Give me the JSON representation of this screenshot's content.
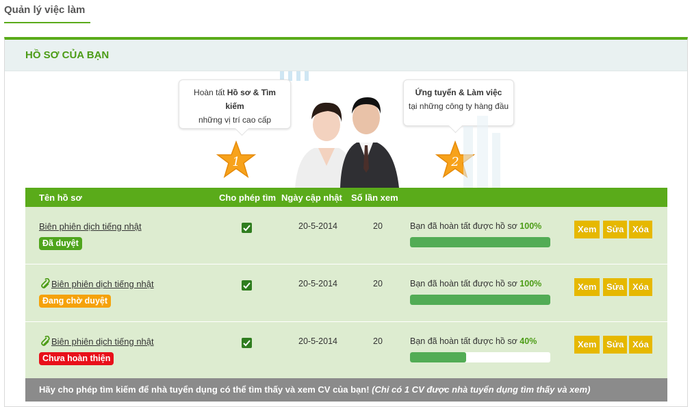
{
  "page_tab": "Quản lý việc làm",
  "panel": {
    "title": "HỒ SƠ CỦA BẠN",
    "banner": {
      "step1": {
        "number": "1",
        "line1_pre": "Hoàn tất ",
        "line1_bold": "Hồ sơ & Tìm kiếm",
        "line2": "những vị trí cao cấp"
      },
      "step2": {
        "number": "2",
        "line1_bold": "Ứng tuyển & Làm việc",
        "line2": "tại những công ty hàng đầu"
      }
    },
    "table": {
      "headers": {
        "name": "Tên hồ sơ",
        "allow_search": "Cho phép tìm",
        "updated": "Ngày cập nhật",
        "views": "Số lần xem"
      },
      "progress_prefix": "Bạn đã hoàn tất được hồ sơ",
      "buttons": {
        "view": "Xem",
        "edit": "Sửa",
        "delete": "Xóa"
      },
      "rows": [
        {
          "name": "Biên phiên dịch tiếng nhật",
          "attachment": false,
          "status": "Đã duyệt",
          "status_color": "#4fa51d",
          "allow_search": true,
          "updated": "20-5-2014",
          "views": "20",
          "progress": "100%",
          "progress_value": 100
        },
        {
          "name": "Biên phiên dịch tiếng nhật",
          "attachment": true,
          "status": "Đang chờ duyệt",
          "status_color": "#f5a20a",
          "allow_search": true,
          "updated": "20-5-2014",
          "views": "20",
          "progress": "100%",
          "progress_value": 100
        },
        {
          "name": "Biên phiên dịch tiếng nhật",
          "attachment": true,
          "status": "Chưa hoàn thiện",
          "status_color": "#e8101a",
          "allow_search": true,
          "updated": "20-5-2014",
          "views": "20",
          "progress": "40%",
          "progress_value": 40
        }
      ]
    },
    "footer_note": {
      "main": "Hãy cho phép tìm kiếm để nhà tuyển dụng có thể tìm thấy và xem CV của bạn!",
      "italic": "(Chỉ có 1 CV được nhà tuyển dụng tìm thấy và xem)"
    }
  },
  "colors": {
    "accent": "#5aab1a",
    "button": "#e6b800",
    "row_bg": "#ddecd0",
    "progress": "#52ac55"
  },
  "icons": {
    "star": "star-icon",
    "attachment": "paperclip-icon",
    "checkbox": "checkbox-checked-icon"
  }
}
